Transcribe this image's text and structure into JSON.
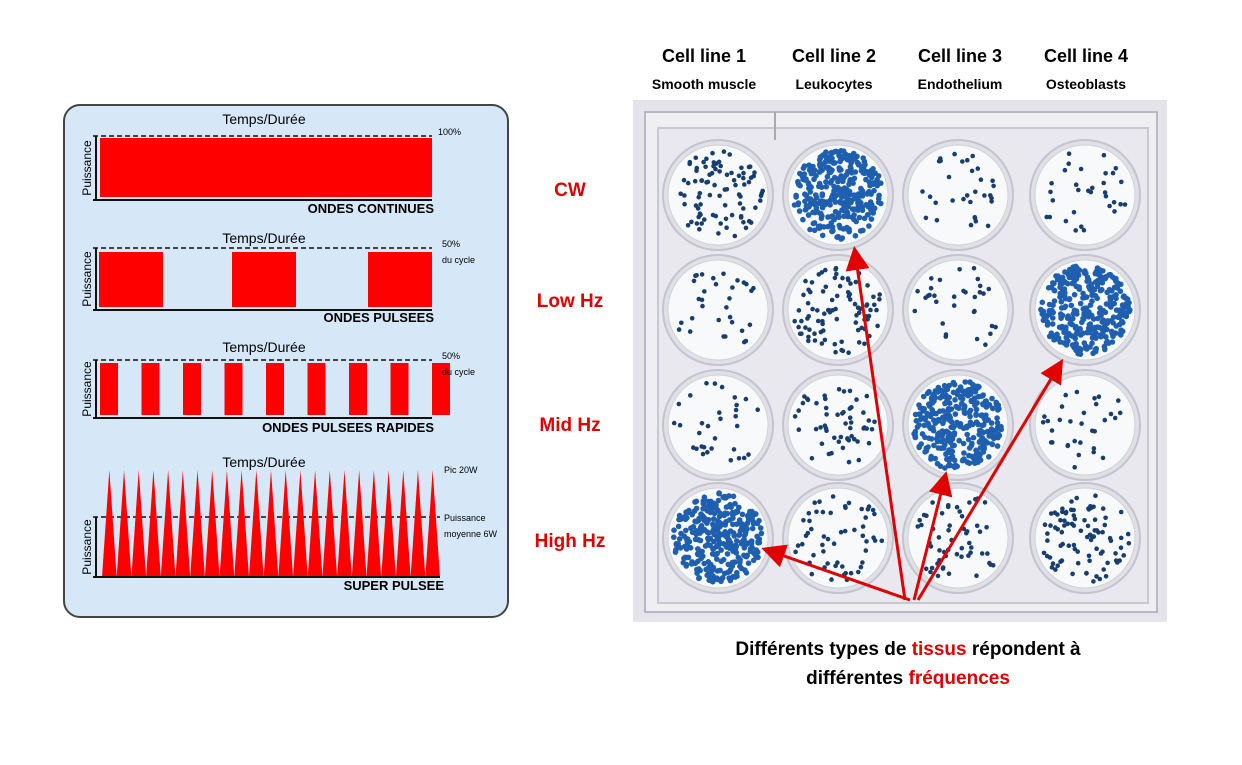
{
  "colors": {
    "pulse": "#ff0000",
    "label_red": "#e00000",
    "panel_bg": "#d6e8f8",
    "stain": "#1f5fb0",
    "arrow": "#e00000"
  },
  "waveforms": [
    {
      "axis_x": "Temps/Durée",
      "axis_y": "Puissance",
      "level_label": [
        "100%"
      ],
      "title": "ONDES CONTINUES",
      "pulses": 1
    },
    {
      "axis_x": "Temps/Durée",
      "axis_y": "Puissance",
      "level_label": [
        "50%",
        "du cycle"
      ],
      "title": "ONDES PULSEES",
      "pulses": 3
    },
    {
      "axis_x": "Temps/Durée",
      "axis_y": "Puissance",
      "level_label": [
        "50%",
        "du cycle"
      ],
      "title": "ONDES PULSEES RAPIDES",
      "pulses": 9
    },
    {
      "axis_x": "Temps/Durée",
      "axis_y": "Puissance",
      "peak_label": "Pic 20W",
      "level_label": [
        "Puissance",
        "moyenne 6W"
      ],
      "title": "SUPER PULSEE",
      "pulses": 23
    }
  ],
  "columns": [
    {
      "title": "Cell line 1",
      "subtitle": "Smooth muscle"
    },
    {
      "title": "Cell line 2",
      "subtitle": "Leukocytes"
    },
    {
      "title": "Cell line 3",
      "subtitle": "Endothelium"
    },
    {
      "title": "Cell line 4",
      "subtitle": "Osteoblasts"
    }
  ],
  "rows": [
    "CW",
    "Low Hz",
    "Mid Hz",
    "High Hz"
  ],
  "wells": [
    [
      "medium",
      "dense",
      "sparse",
      "sparse"
    ],
    [
      "sparse",
      "medium",
      "sparse",
      "dense"
    ],
    [
      "sparse",
      "light",
      "dense",
      "sparse"
    ],
    [
      "dense",
      "light",
      "light",
      "medium"
    ]
  ],
  "caption": {
    "line1_a": "Différents types de ",
    "line1_red": "tissus",
    "line1_b": " répondent à",
    "line2_a": "différentes ",
    "line2_red": "fréquences"
  }
}
